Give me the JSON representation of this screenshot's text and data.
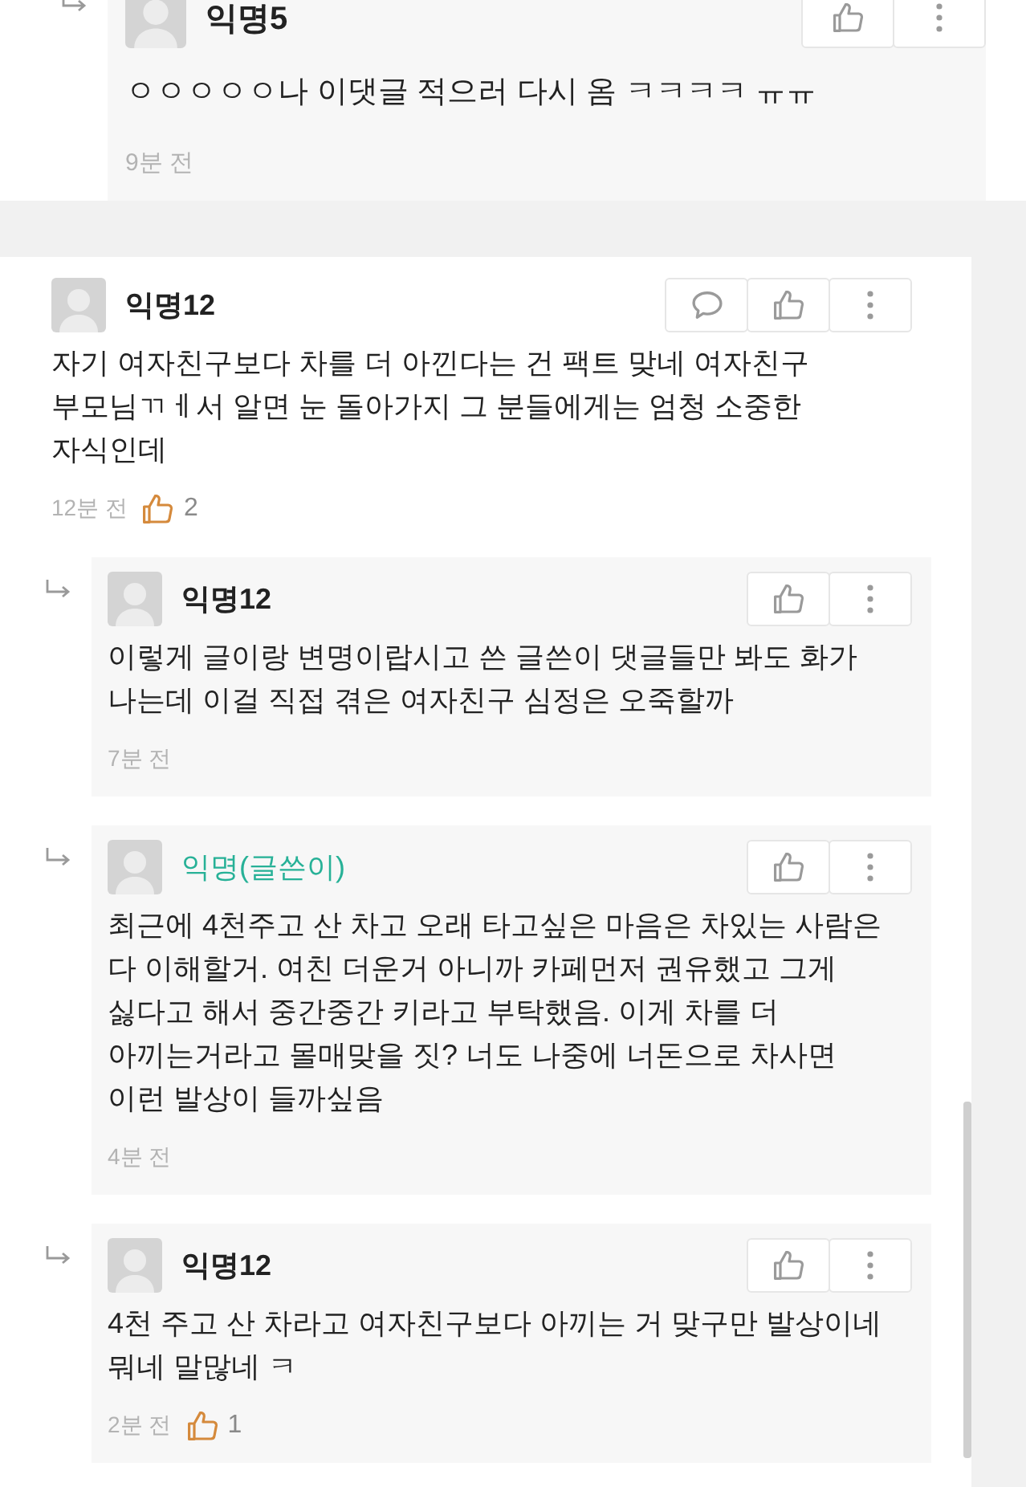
{
  "previous_thread": {
    "replies": [
      {
        "author": "익명5",
        "writer": false,
        "text": "ㅇㅇㅇㅇㅇ나 이댓글 적으러 다시 옴 ㅋㅋㅋㅋ ㅠㅠ",
        "time": "9분 전",
        "buttons": [
          {
            "kind": "like"
          },
          {
            "kind": "more"
          }
        ]
      }
    ]
  },
  "thread": {
    "comment": {
      "author": "익명12",
      "writer": false,
      "text": "자기 여자친구보다 차를 더 아낀다는 건 팩트 맞네 여자친구\n부모님ㄲㅔ서 알면 눈 돌아가지 그 분들에게는 엄청 소중한\n자식인데",
      "time": "12분 전",
      "likes": "2",
      "buttons": [
        {
          "kind": "reply"
        },
        {
          "kind": "like"
        },
        {
          "kind": "more"
        }
      ]
    },
    "replies": [
      {
        "author": "익명12",
        "writer": false,
        "text": "이렇게 글이랑 변명이랍시고 쓴 글쓴이 댓글들만 봐도 화가\n나는데 이걸 직접 겪은 여자친구 심정은 오죽할까",
        "time": "7분 전",
        "buttons": [
          {
            "kind": "like"
          },
          {
            "kind": "more"
          }
        ]
      },
      {
        "author": "익명(글쓴이)",
        "writer": true,
        "text": "최근에 4천주고 산 차고 오래 타고싶은 마음은 차있는 사람은\n다 이해할거. 여친 더운거 아니까 카페먼저 권유했고 그게\n싫다고 해서 중간중간 키라고 부탁했음. 이게 차를 더\n아끼는거라고 몰매맞을 짓? 너도 나중에 너돈으로 차사면\n이런 발상이 들까싶음",
        "time": "4분 전",
        "buttons": [
          {
            "kind": "like"
          },
          {
            "kind": "more"
          }
        ]
      },
      {
        "author": "익명12",
        "writer": false,
        "text": "4천 주고 산 차라고 여자친구보다 아끼는 거 맞구만 발상이네\n뭐네 말많네 ㅋ",
        "time": "2분 전",
        "likes": "1",
        "buttons": [
          {
            "kind": "like"
          },
          {
            "kind": "more"
          }
        ]
      }
    ]
  }
}
